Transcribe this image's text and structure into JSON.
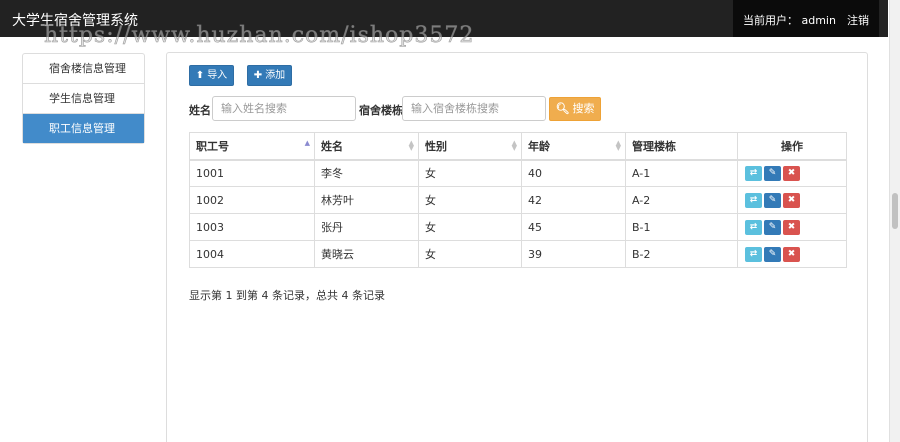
{
  "app": {
    "title": "大学生宿舍管理系统"
  },
  "header": {
    "user_label": "当前用户：  admin",
    "logout_label": "注销"
  },
  "watermark": "https://www.huzhan.com/ishop3572",
  "sidebar": {
    "items": [
      {
        "label": "宿舍楼信息管理",
        "active": false
      },
      {
        "label": "学生信息管理",
        "active": false
      },
      {
        "label": "职工信息管理",
        "active": true
      }
    ]
  },
  "toolbar": {
    "import_label": "导入",
    "import_icon": "upload-icon",
    "add_label": "添加",
    "add_icon": "plus-icon"
  },
  "search": {
    "name_label": "姓名",
    "name_placeholder": "输入姓名搜索",
    "building_label": "宿舍楼栋",
    "building_placeholder": "输入宿舍楼栋搜索",
    "button_label": "搜索",
    "button_icon": "search-icon"
  },
  "table": {
    "columns": [
      "职工号",
      "姓名",
      "性别",
      "年龄",
      "管理楼栋",
      "操作"
    ],
    "sorted_column": "职工号",
    "sort_direction": "asc",
    "rows": [
      {
        "id": "1001",
        "name": "李冬",
        "gender": "女",
        "age": "40",
        "building": "A-1"
      },
      {
        "id": "1002",
        "name": "林芳叶",
        "gender": "女",
        "age": "42",
        "building": "A-2"
      },
      {
        "id": "1003",
        "name": "张丹",
        "gender": "女",
        "age": "45",
        "building": "B-1"
      },
      {
        "id": "1004",
        "name": "黄晓云",
        "gender": "女",
        "age": "39",
        "building": "B-2"
      }
    ],
    "row_actions": [
      "refresh-icon",
      "pencil-icon",
      "close-icon"
    ]
  },
  "pagination": {
    "summary": "显示第 1 到第 4 条记录，总共 4 条记录"
  },
  "colors": {
    "navbar": "#222222",
    "primary": "#337ab7",
    "active_nav": "#428bca",
    "warning": "#f0ad4e",
    "info": "#5bc0de",
    "danger": "#d9534f"
  }
}
